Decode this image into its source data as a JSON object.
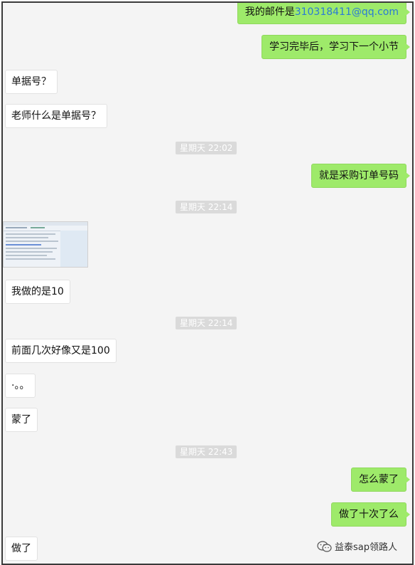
{
  "messages": {
    "m1_prefix": "我的邮件是",
    "m1_email": "310318411@qq.com",
    "m2": "学习完毕后，学习下一个小节",
    "m3": "单据号？",
    "m4": "老师什么是单据号？",
    "t1": "星期天 22:02",
    "m5": "就是采购订单号码",
    "t2": "星期天 22:14",
    "m7": "我做的是10",
    "t3": "星期天 22:14",
    "m8": "前面几次好像又是100",
    "m9": "·。。",
    "m10": "蒙了",
    "t4": "星期天 22:43",
    "m11": "怎么蒙了",
    "m12": "做了十次了么",
    "m13": "做了"
  },
  "watermark": {
    "text": "益泰sap领路人",
    "icon": "wechat-icon"
  },
  "colors": {
    "sent_bubble": "#9eea6a",
    "received_bubble": "#ffffff",
    "link": "#2a7ad6"
  }
}
